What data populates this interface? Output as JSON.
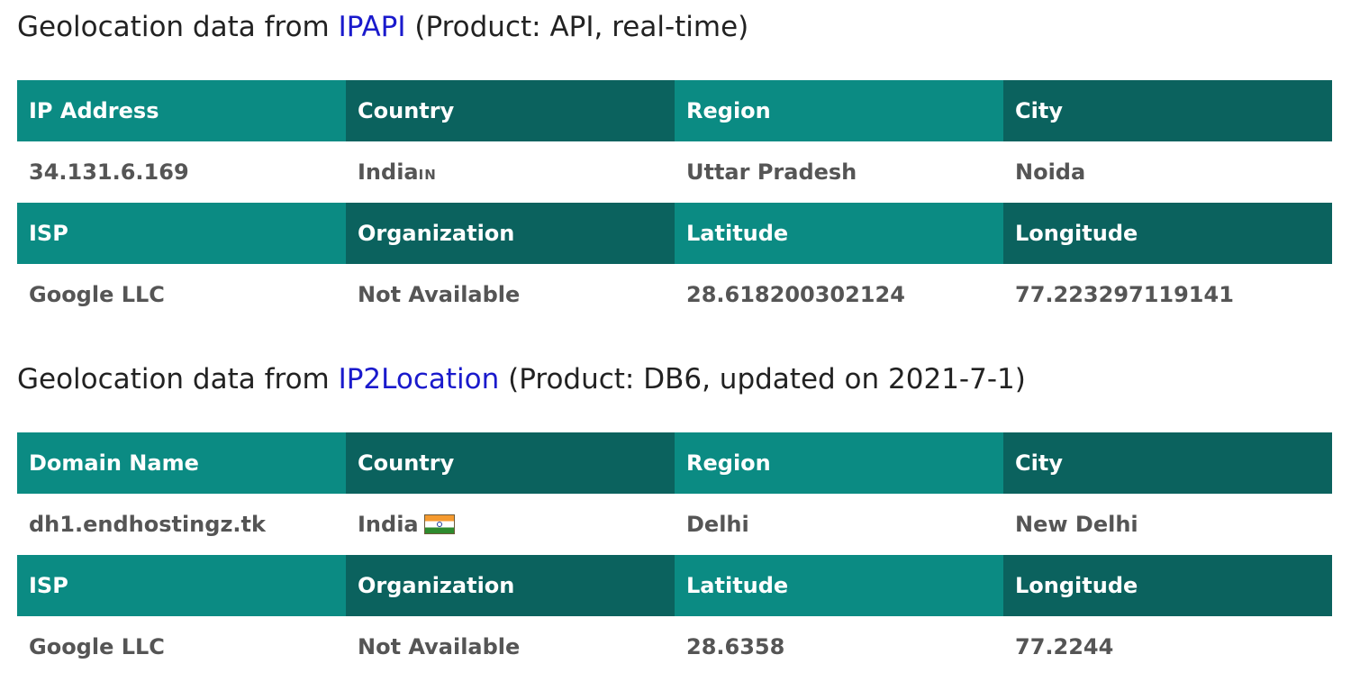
{
  "section1": {
    "title_prefix": "Geolocation data from ",
    "provider_link": "IPAPI",
    "title_suffix": " (Product: API, real-time)",
    "row1_headers": [
      "IP Address",
      "Country",
      "Region",
      "City"
    ],
    "row1_values": {
      "ip_address": "34.131.6.169",
      "country": "India",
      "country_code": "IN",
      "region": "Uttar Pradesh",
      "city": "Noida"
    },
    "row2_headers": [
      "ISP",
      "Organization",
      "Latitude",
      "Longitude"
    ],
    "row2_values": {
      "isp": "Google LLC",
      "organization": "Not Available",
      "latitude": "28.618200302124",
      "longitude": "77.223297119141"
    }
  },
  "section2": {
    "title_prefix": "Geolocation data from ",
    "provider_link": "IP2Location",
    "title_suffix": " (Product: DB6, updated on 2021-7-1)",
    "row1_headers": [
      "Domain Name",
      "Country",
      "Region",
      "City"
    ],
    "row1_values": {
      "domain_name": "dh1.endhostingz.tk",
      "country": "India",
      "flag_icon": "india-flag-icon",
      "region": "Delhi",
      "city": "New Delhi"
    },
    "row2_headers": [
      "ISP",
      "Organization",
      "Latitude",
      "Longitude"
    ],
    "row2_values": {
      "isp": "Google LLC",
      "organization": "Not Available",
      "latitude": "28.6358",
      "longitude": "77.2244"
    }
  },
  "colors": {
    "header_light": "#0b8b83",
    "header_dark": "#0b625e",
    "link": "#1a1acc",
    "cell_text": "#555555"
  }
}
